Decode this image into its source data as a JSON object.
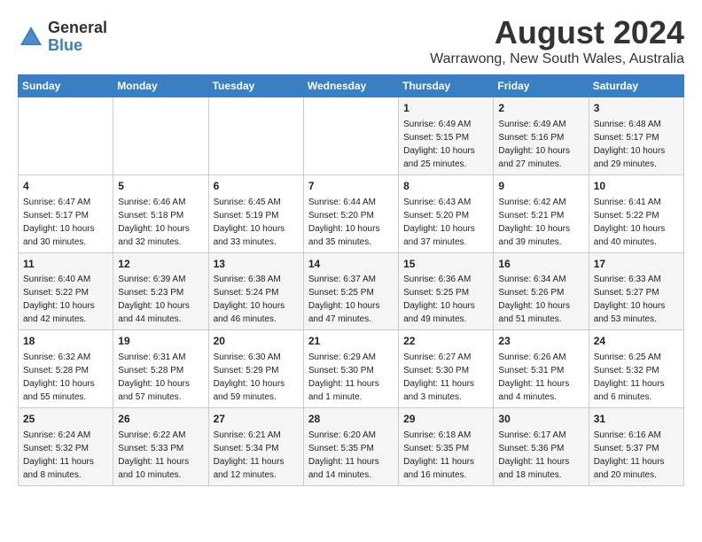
{
  "header": {
    "logo_general": "General",
    "logo_blue": "Blue",
    "month": "August 2024",
    "location": "Warrawong, New South Wales, Australia"
  },
  "days_of_week": [
    "Sunday",
    "Monday",
    "Tuesday",
    "Wednesday",
    "Thursday",
    "Friday",
    "Saturday"
  ],
  "weeks": [
    [
      {
        "day": "",
        "sunrise": "",
        "sunset": "",
        "daylight": ""
      },
      {
        "day": "",
        "sunrise": "",
        "sunset": "",
        "daylight": ""
      },
      {
        "day": "",
        "sunrise": "",
        "sunset": "",
        "daylight": ""
      },
      {
        "day": "",
        "sunrise": "",
        "sunset": "",
        "daylight": ""
      },
      {
        "day": "1",
        "sunrise": "Sunrise: 6:49 AM",
        "sunset": "Sunset: 5:15 PM",
        "daylight": "Daylight: 10 hours and 25 minutes."
      },
      {
        "day": "2",
        "sunrise": "Sunrise: 6:49 AM",
        "sunset": "Sunset: 5:16 PM",
        "daylight": "Daylight: 10 hours and 27 minutes."
      },
      {
        "day": "3",
        "sunrise": "Sunrise: 6:48 AM",
        "sunset": "Sunset: 5:17 PM",
        "daylight": "Daylight: 10 hours and 29 minutes."
      }
    ],
    [
      {
        "day": "4",
        "sunrise": "Sunrise: 6:47 AM",
        "sunset": "Sunset: 5:17 PM",
        "daylight": "Daylight: 10 hours and 30 minutes."
      },
      {
        "day": "5",
        "sunrise": "Sunrise: 6:46 AM",
        "sunset": "Sunset: 5:18 PM",
        "daylight": "Daylight: 10 hours and 32 minutes."
      },
      {
        "day": "6",
        "sunrise": "Sunrise: 6:45 AM",
        "sunset": "Sunset: 5:19 PM",
        "daylight": "Daylight: 10 hours and 33 minutes."
      },
      {
        "day": "7",
        "sunrise": "Sunrise: 6:44 AM",
        "sunset": "Sunset: 5:20 PM",
        "daylight": "Daylight: 10 hours and 35 minutes."
      },
      {
        "day": "8",
        "sunrise": "Sunrise: 6:43 AM",
        "sunset": "Sunset: 5:20 PM",
        "daylight": "Daylight: 10 hours and 37 minutes."
      },
      {
        "day": "9",
        "sunrise": "Sunrise: 6:42 AM",
        "sunset": "Sunset: 5:21 PM",
        "daylight": "Daylight: 10 hours and 39 minutes."
      },
      {
        "day": "10",
        "sunrise": "Sunrise: 6:41 AM",
        "sunset": "Sunset: 5:22 PM",
        "daylight": "Daylight: 10 hours and 40 minutes."
      }
    ],
    [
      {
        "day": "11",
        "sunrise": "Sunrise: 6:40 AM",
        "sunset": "Sunset: 5:22 PM",
        "daylight": "Daylight: 10 hours and 42 minutes."
      },
      {
        "day": "12",
        "sunrise": "Sunrise: 6:39 AM",
        "sunset": "Sunset: 5:23 PM",
        "daylight": "Daylight: 10 hours and 44 minutes."
      },
      {
        "day": "13",
        "sunrise": "Sunrise: 6:38 AM",
        "sunset": "Sunset: 5:24 PM",
        "daylight": "Daylight: 10 hours and 46 minutes."
      },
      {
        "day": "14",
        "sunrise": "Sunrise: 6:37 AM",
        "sunset": "Sunset: 5:25 PM",
        "daylight": "Daylight: 10 hours and 47 minutes."
      },
      {
        "day": "15",
        "sunrise": "Sunrise: 6:36 AM",
        "sunset": "Sunset: 5:25 PM",
        "daylight": "Daylight: 10 hours and 49 minutes."
      },
      {
        "day": "16",
        "sunrise": "Sunrise: 6:34 AM",
        "sunset": "Sunset: 5:26 PM",
        "daylight": "Daylight: 10 hours and 51 minutes."
      },
      {
        "day": "17",
        "sunrise": "Sunrise: 6:33 AM",
        "sunset": "Sunset: 5:27 PM",
        "daylight": "Daylight: 10 hours and 53 minutes."
      }
    ],
    [
      {
        "day": "18",
        "sunrise": "Sunrise: 6:32 AM",
        "sunset": "Sunset: 5:28 PM",
        "daylight": "Daylight: 10 hours and 55 minutes."
      },
      {
        "day": "19",
        "sunrise": "Sunrise: 6:31 AM",
        "sunset": "Sunset: 5:28 PM",
        "daylight": "Daylight: 10 hours and 57 minutes."
      },
      {
        "day": "20",
        "sunrise": "Sunrise: 6:30 AM",
        "sunset": "Sunset: 5:29 PM",
        "daylight": "Daylight: 10 hours and 59 minutes."
      },
      {
        "day": "21",
        "sunrise": "Sunrise: 6:29 AM",
        "sunset": "Sunset: 5:30 PM",
        "daylight": "Daylight: 11 hours and 1 minute."
      },
      {
        "day": "22",
        "sunrise": "Sunrise: 6:27 AM",
        "sunset": "Sunset: 5:30 PM",
        "daylight": "Daylight: 11 hours and 3 minutes."
      },
      {
        "day": "23",
        "sunrise": "Sunrise: 6:26 AM",
        "sunset": "Sunset: 5:31 PM",
        "daylight": "Daylight: 11 hours and 4 minutes."
      },
      {
        "day": "24",
        "sunrise": "Sunrise: 6:25 AM",
        "sunset": "Sunset: 5:32 PM",
        "daylight": "Daylight: 11 hours and 6 minutes."
      }
    ],
    [
      {
        "day": "25",
        "sunrise": "Sunrise: 6:24 AM",
        "sunset": "Sunset: 5:32 PM",
        "daylight": "Daylight: 11 hours and 8 minutes."
      },
      {
        "day": "26",
        "sunrise": "Sunrise: 6:22 AM",
        "sunset": "Sunset: 5:33 PM",
        "daylight": "Daylight: 11 hours and 10 minutes."
      },
      {
        "day": "27",
        "sunrise": "Sunrise: 6:21 AM",
        "sunset": "Sunset: 5:34 PM",
        "daylight": "Daylight: 11 hours and 12 minutes."
      },
      {
        "day": "28",
        "sunrise": "Sunrise: 6:20 AM",
        "sunset": "Sunset: 5:35 PM",
        "daylight": "Daylight: 11 hours and 14 minutes."
      },
      {
        "day": "29",
        "sunrise": "Sunrise: 6:18 AM",
        "sunset": "Sunset: 5:35 PM",
        "daylight": "Daylight: 11 hours and 16 minutes."
      },
      {
        "day": "30",
        "sunrise": "Sunrise: 6:17 AM",
        "sunset": "Sunset: 5:36 PM",
        "daylight": "Daylight: 11 hours and 18 minutes."
      },
      {
        "day": "31",
        "sunrise": "Sunrise: 6:16 AM",
        "sunset": "Sunset: 5:37 PM",
        "daylight": "Daylight: 11 hours and 20 minutes."
      }
    ]
  ]
}
